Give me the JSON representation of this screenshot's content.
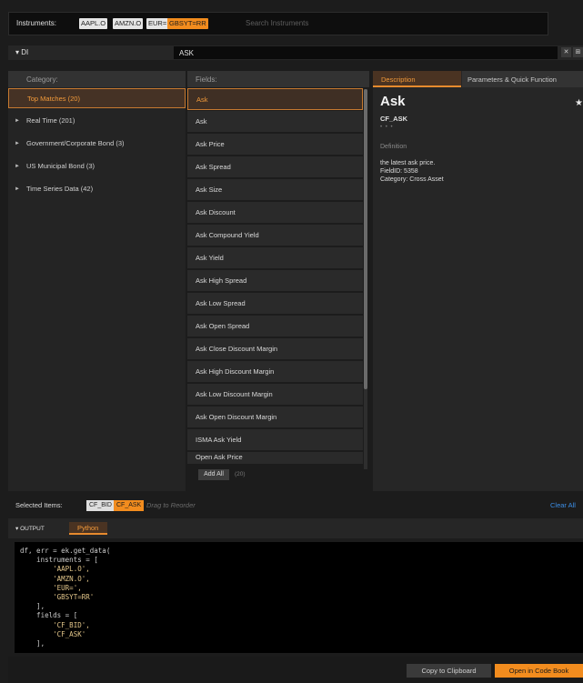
{
  "instruments": {
    "label": "Instruments:",
    "chips": [
      "AAPL.O",
      "AMZN.O",
      "EUR=",
      "GBSYT=RR"
    ],
    "search_placeholder": "Search Instruments"
  },
  "search": {
    "toggle": "▾ DI",
    "value": "ASK",
    "buttons": [
      "✕",
      "⊞"
    ]
  },
  "categories": {
    "header": "Category:",
    "items": [
      {
        "label": "Top Matches (20)"
      },
      {
        "label": "Real Time (201)"
      },
      {
        "label": "Government/Corporate Bond (3)"
      },
      {
        "label": "US Municipal Bond (3)"
      },
      {
        "label": "Time Series Data (42)"
      }
    ]
  },
  "fields": {
    "header": "Fields:",
    "items": [
      "Ask",
      "Ask",
      "Ask Price",
      "Ask Spread",
      "Ask Size",
      "Ask Discount",
      "Ask Compound Yield",
      "Ask Yield",
      "Ask High Spread",
      "Ask Low Spread",
      "Ask Open Spread",
      "Ask Close Discount Margin",
      "Ask High Discount Margin",
      "Ask Low Discount Margin",
      "Ask Open Discount Margin",
      "ISMA Ask Yield",
      "Open Ask Price"
    ],
    "add_all": "Add All",
    "add_all_count": "(20)"
  },
  "description": {
    "tab_description": "Description",
    "tab_params": "Parameters & Quick Function",
    "title": "Ask",
    "code": "CF_ASK",
    "dots": "• • •",
    "definition_label": "Definition",
    "lines": [
      "the latest ask price.",
      "FieldID: 5358",
      "Category: Cross Asset"
    ]
  },
  "selected": {
    "label": "Selected Items:",
    "chips": [
      "CF_BID",
      "CF_ASK"
    ],
    "hint": "Drag to Reorder",
    "clear_all": "Clear All"
  },
  "output": {
    "toggle": "▾ OUTPUT",
    "tab": "Python",
    "code_lines": [
      "df, err = ek.get_data(",
      "    instruments = [",
      "        'AAPL.O',",
      "        'AMZN.O',",
      "        'EUR=',",
      "        'GBSYT=RR'",
      "    ],",
      "    fields = [",
      "        'CF_BID',",
      "        'CF_ASK'",
      "    ],"
    ]
  },
  "footer": {
    "copy": "Copy to Clipboard",
    "open": "Open in Code Book"
  }
}
